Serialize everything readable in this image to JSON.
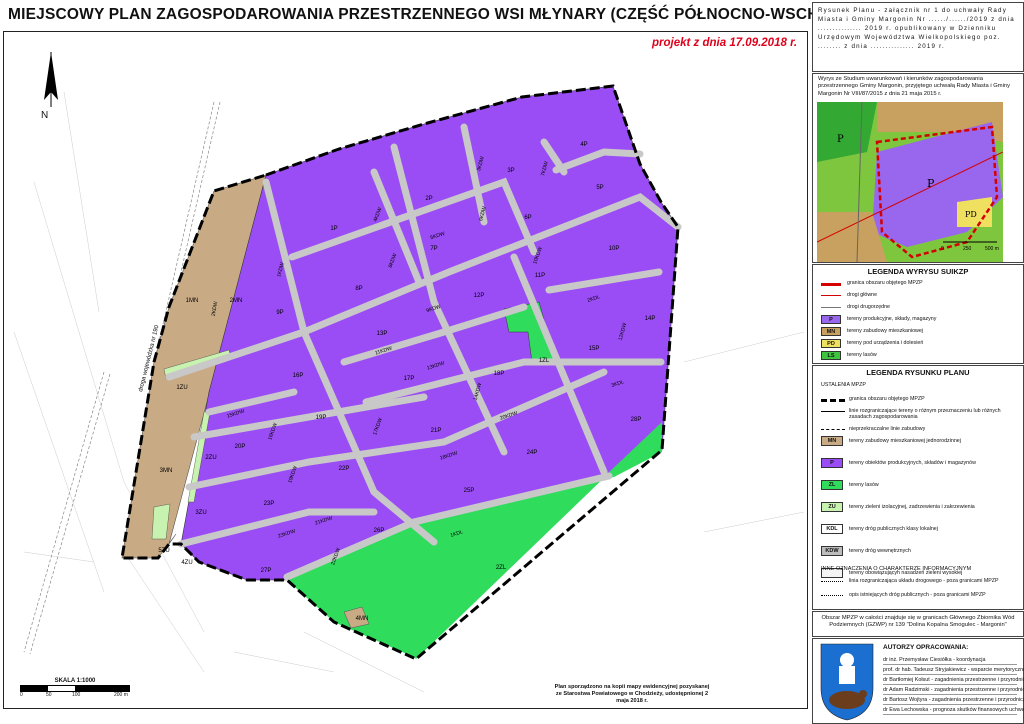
{
  "title": "MIEJSCOWY PLAN ZAGOSPODAROWANIA PRZESTRZENNEGO WSI MŁYNARY (CZĘŚĆ PÓŁNOCNO-WSCHODNIA)",
  "projekt": "projekt z dnia 17.09.2018 r.",
  "north_label": "N",
  "road_label": "droga wojewódzka nr 190",
  "zones": {
    "mn": [
      "1MN",
      "2MN",
      "3MN",
      "4MN"
    ],
    "p": [
      "1P",
      "2P",
      "3P",
      "4P",
      "5P",
      "6P",
      "7P",
      "8P",
      "9P",
      "10P",
      "11P",
      "12P",
      "13P",
      "14P",
      "15P",
      "16P",
      "17P",
      "18P",
      "19P",
      "20P",
      "21P",
      "22P",
      "23P",
      "24P",
      "25P",
      "26P",
      "27P",
      "28P"
    ],
    "zl": [
      "1ZL",
      "2ZL"
    ],
    "zu": [
      "1ZU",
      "2ZU",
      "3ZU",
      "4ZU",
      "5ZU"
    ]
  },
  "streets": [
    "1KDW",
    "2KDW",
    "3KDW",
    "4KDW",
    "5KDW",
    "6KDW",
    "7KDW",
    "8KDW",
    "9KDW",
    "10KDW",
    "11KDW",
    "12KDW",
    "13KDW",
    "14KDW",
    "15KDW",
    "16KDW",
    "17KDW",
    "18KDW",
    "19KDW",
    "20KDW",
    "21KDW",
    "22KDW",
    "23KDW",
    "1KDL",
    "2KDL",
    "3KDL"
  ],
  "drawing_note": "Rysunek Planu - załącznik nr 1 do uchwały Rady Miasta i Gminy Margonin Nr ....../....../2019 z dnia ............... 2019 r. opublikowany w Dzienniku Urzędowym Województwa Wielkopolskiego poz. ........ z dnia ............... 2019 r.",
  "study_excerpt": {
    "text": "Wyrys ze Studium uwarunkowań i kierunków zagospodarowania przestrzennego Gminy Margonin, przyjętego uchwałą Rady Miasta i Gminy Margonin Nr VIII/87/2015 z dnia 21 maja 2015 r.",
    "scale_labels": [
      "0",
      "250",
      "500 m"
    ],
    "map_labels": [
      "P",
      "P",
      "PD"
    ]
  },
  "legend_suikzp": {
    "title": "LEGENDA WYRYSU SUIKZP",
    "items": [
      {
        "code": "",
        "label": "granica obszaru objętego MPZP",
        "color": "#d40000"
      },
      {
        "code": "",
        "label": "drogi główne",
        "color": "#d40000"
      },
      {
        "code": "",
        "label": "drogi drugorzędne",
        "color": "#777777"
      },
      {
        "code": "P",
        "label": "tereny produkcyjne, składy, magazyny",
        "color": "#9966ee"
      },
      {
        "code": "MN",
        "label": "tereny zabudowy mieszkaniowej",
        "color": "#c8a060"
      },
      {
        "code": "PD",
        "label": "tereny pod urządzenia i dolesień",
        "color": "#f0e060"
      },
      {
        "code": "LS",
        "label": "tereny lasów",
        "color": "#3ec43e"
      }
    ]
  },
  "legend_plan": {
    "title": "LEGENDA RYSUNKU PLANU",
    "subtitle": "USTALENIA MPZP",
    "lines": [
      "granica obszaru objętego MPZP",
      "linie rozgraniczające tereny o różnym przeznaczeniu lub różnych zasadach zagospodarowania",
      "nieprzekraczalne linie zabudowy"
    ],
    "items": [
      {
        "code": "MN",
        "label": "tereny zabudowy mieszkaniowej jednorodzinnej",
        "color": "#c8ab85"
      },
      {
        "code": "P",
        "label": "tereny obiektów produkcyjnych, składów i magazynów",
        "color": "#9b4df5"
      },
      {
        "code": "ZL",
        "label": "tereny lasów",
        "color": "#2fdc5c"
      },
      {
        "code": "ZU",
        "label": "tereny zieleni izolacyjnej, zadrzewienia i zakrzewienia",
        "color": "#c8f2b0"
      },
      {
        "code": "KDL",
        "label": "tereny dróg publicznych klasy lokalnej",
        "color": "#ffffff"
      },
      {
        "code": "KDW",
        "label": "tereny dróg wewnętrznych",
        "color": "#bdbdbd"
      },
      {
        "code": "",
        "label": "tereny obowiązującyh nasadzeń zieleni wysokiej",
        "color": "#f4f4f4"
      }
    ],
    "info_title": "INNE OZNACZENIA O CHARAKTERZE INFORMACYJNYM",
    "info_items": [
      "linia rozgraniczająca układu drogowego - poza granicami MPZP",
      "opis istniejących dróg publicznych - poza granicami MPZP"
    ]
  },
  "footnote": "Obszar MPZP w całości znajduje się w granicach Głównego Zbiornika Wód Podziemnych (GZWP) nr 139 \"Dolina Kopalna Smogulec - Margonin\"",
  "authors": {
    "title": "AUTORZY OPRACOWANIA:",
    "list": [
      "dr inż. Przemysław Ciesiółka - koordynacja",
      "prof. dr hab. Tadeusz Stryjakiewicz - wsparcie merytoryczne",
      "dr Bartłomiej Kołsut - zagadnienia przestrzenne i przyrodnicze",
      "dr Adam Radzimski - zagadnienia przestrzenne i przyrodnicze",
      "dr Bartosz Wojtyra - zagadnienia przestrzenne i przyrodnicze",
      "dr Ewa Lechowska - prognoza skutków finansowych uchwalenia MPZP"
    ]
  },
  "scale": {
    "label": "SKALA 1:1000",
    "ticks": [
      "0",
      "50",
      "100",
      "200 m"
    ]
  },
  "base_map_note": "Plan sporządzono na kopii mapy ewidencyjnej pozyskanej ze Starostwa Powiatowego w Chodzieży, udostępnionej 2 maja 2018 r.",
  "colors": {
    "p": "#9b4df5",
    "mn": "#c8ab85",
    "zl": "#2fdc5c",
    "zu": "#c8f2b0",
    "road": "#c8c8c8",
    "boundary": "#000000",
    "projekt": "#e0001b"
  }
}
